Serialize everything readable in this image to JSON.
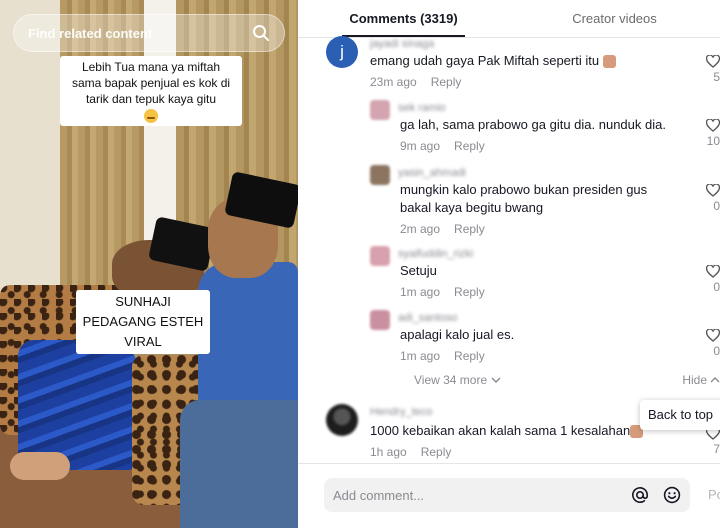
{
  "video": {
    "search_placeholder": "Find related content",
    "caption_top": "Lebih Tua mana ya miftah sama bapak penjual es kok di tarik dan tepuk kaya gitu",
    "caption_bottom_lines": [
      "SUNHAJI",
      "PEDAGANG ESTEH",
      "VIRAL"
    ]
  },
  "tabs": {
    "comments": "Comments (3319)",
    "creator_videos": "Creator videos"
  },
  "comments": [
    {
      "avatar_letter": "j",
      "username": "jayadi sinaga",
      "text": "emang udah gaya Pak Miftah seperti itu",
      "time": "23m ago",
      "reply": "Reply",
      "likes": "5"
    },
    {
      "username": "sek ramio",
      "text": "ga lah, sama prabowo ga gitu dia. nunduk dia.",
      "time": "9m ago",
      "reply": "Reply",
      "likes": "10"
    },
    {
      "username": "yasin_ahmadi",
      "text": "mungkin kalo prabowo bukan presiden gus bakal kaya begitu bwang",
      "time": "2m ago",
      "reply": "Reply",
      "likes": "0"
    },
    {
      "username": "syaifuddin_rizki",
      "text": "Setuju",
      "time": "1m ago",
      "reply": "Reply",
      "likes": "0"
    },
    {
      "username": "adi_santoso",
      "text": "apalagi kalo jual es.",
      "time": "1m ago",
      "reply": "Reply",
      "likes": "0"
    },
    {
      "username": "Hendry_teco",
      "text": "1000 kebaikan akan kalah sama 1 kesalahan",
      "time": "1h ago",
      "reply": "Reply",
      "likes": "7"
    }
  ],
  "view_more": "View 34 more",
  "hide": "Hide",
  "back_to_top": "Back to top",
  "input": {
    "placeholder": "Add comment...",
    "post": "Post"
  },
  "colors": {
    "avatar_j": "#2b5fb4",
    "text": "#161823",
    "muted": "#8a8b91"
  },
  "icons": [
    "search-icon",
    "heart-icon",
    "chevron-down-icon",
    "chevron-up-icon",
    "at-icon",
    "emoji-icon"
  ]
}
